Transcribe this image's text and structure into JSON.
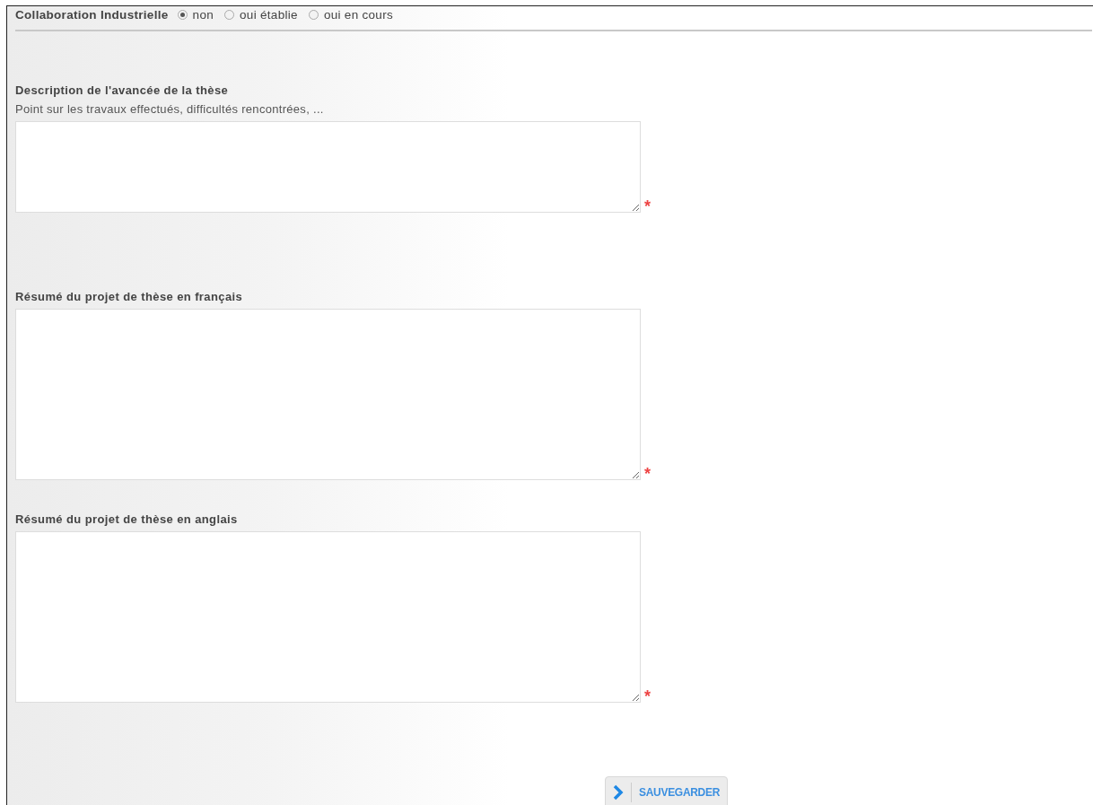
{
  "collaboration": {
    "label": "Collaboration Industrielle",
    "options": [
      {
        "label": "non",
        "selected": true
      },
      {
        "label": "oui établie",
        "selected": false
      },
      {
        "label": "oui en cours",
        "selected": false
      }
    ]
  },
  "fields": [
    {
      "label": "Description de l'avancée de la thèse",
      "hint": "Point sur les travaux effectués, difficultés rencontrées, ...",
      "kind": "short",
      "required_mark": "*"
    },
    {
      "label": "Résumé du projet de thèse en français",
      "kind": "tall",
      "required_mark": "*"
    },
    {
      "label": "Résumé du projet de thèse en anglais",
      "kind": "tall",
      "required_mark": "*"
    }
  ],
  "save_button": {
    "label": "SAUVEGARDER"
  }
}
